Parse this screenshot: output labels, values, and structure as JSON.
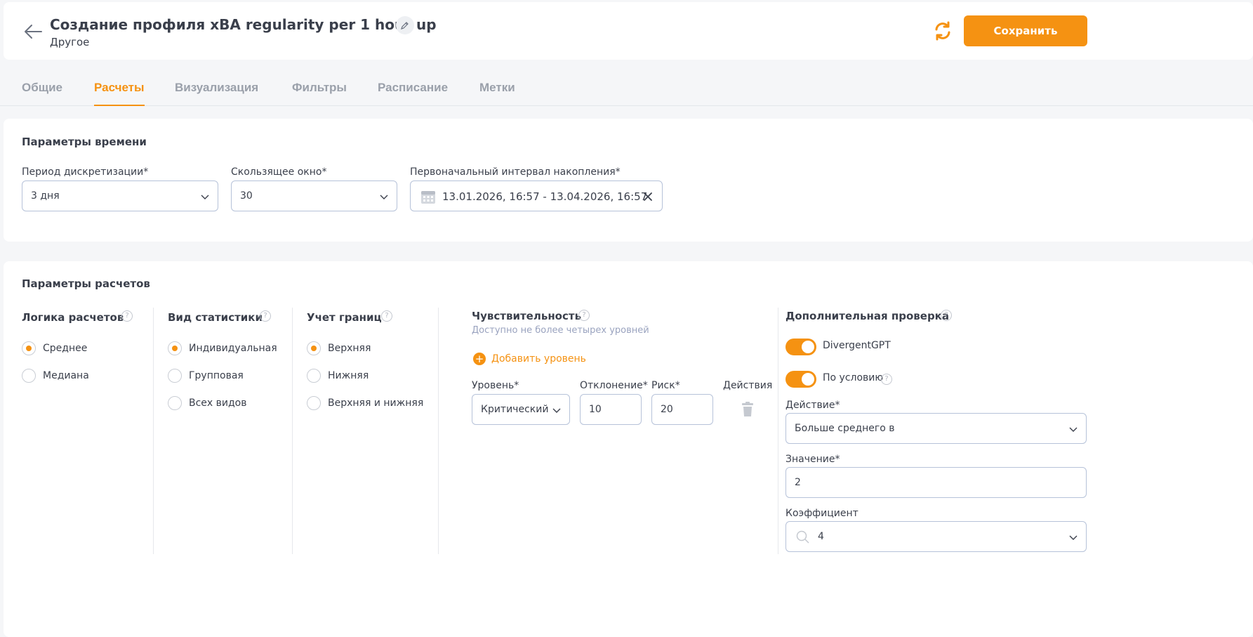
{
  "header": {
    "title": "Создание профиля xBA regularity per 1 hour up",
    "subtitle": "Другое",
    "save_label": "Сохранить"
  },
  "tabs": [
    {
      "label": "Общие",
      "active": false
    },
    {
      "label": "Расчеты",
      "active": true
    },
    {
      "label": "Визуализация",
      "active": false
    },
    {
      "label": "Фильтры",
      "active": false
    },
    {
      "label": "Расписание",
      "active": false
    },
    {
      "label": "Метки",
      "active": false
    }
  ],
  "time_params": {
    "title": "Параметры времени",
    "period_label": "Период дискретизации*",
    "period_value": "3 дня",
    "window_label": "Скользящее окно*",
    "window_value": "30",
    "interval_label": "Первоначальный интервал накопления*",
    "interval_value": "13.01.2026, 16:57 - 13.04.2026, 16:57"
  },
  "calc_params": {
    "title": "Параметры расчетов",
    "logic": {
      "title": "Логика расчетов",
      "options": [
        {
          "label": "Среднее",
          "selected": true
        },
        {
          "label": "Медиана",
          "selected": false
        }
      ]
    },
    "stat_type": {
      "title": "Вид статистики",
      "options": [
        {
          "label": "Индивидуальная",
          "selected": true
        },
        {
          "label": "Групповая",
          "selected": false
        },
        {
          "label": "Всех видов",
          "selected": false
        }
      ]
    },
    "bounds": {
      "title": "Учет границ",
      "options": [
        {
          "label": "Верхняя",
          "selected": true
        },
        {
          "label": "Нижняя",
          "selected": false
        },
        {
          "label": "Верхняя и нижняя",
          "selected": false
        }
      ]
    },
    "sensitivity": {
      "title": "Чувствительность",
      "hint": "Доступно не более четырех уровней",
      "add_label": "Добавить уровень",
      "level_label": "Уровень*",
      "deviation_label": "Отклонение*",
      "risk_label": "Риск*",
      "actions_label": "Действия",
      "level_value": "Критический",
      "deviation_value": "10",
      "risk_value": "20"
    },
    "extra_check": {
      "title": "Дополнительная проверка",
      "toggle1_label": "DivergentGPT",
      "toggle1_on": true,
      "toggle2_label": "По условию",
      "toggle2_on": true,
      "action_label": "Действие*",
      "action_value": "Больше среднего в",
      "value_label": "Значение*",
      "value_value": "2",
      "coef_label": "Коэффициент",
      "coef_value": "4"
    }
  },
  "colors": {
    "accent": "#f59212",
    "border": "#b6c2d9"
  }
}
